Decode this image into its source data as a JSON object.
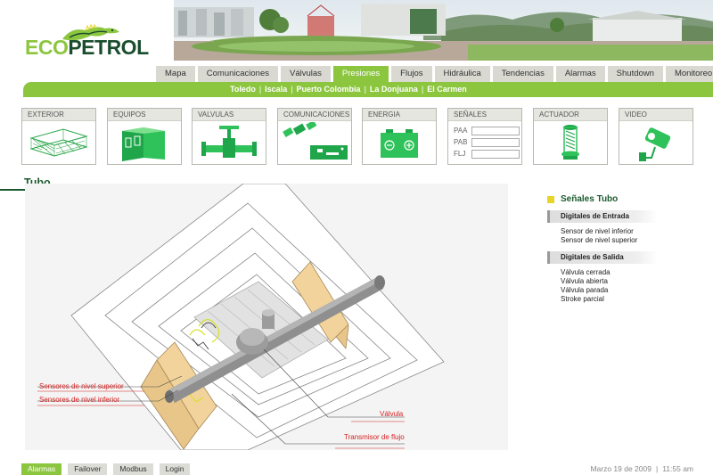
{
  "brand": {
    "eco": "ECO",
    "petrol": "PETROL"
  },
  "nav": {
    "tabs": [
      {
        "label": "Mapa"
      },
      {
        "label": "Comunicaciones"
      },
      {
        "label": "Válvulas"
      },
      {
        "label": "Presiones"
      },
      {
        "label": "Flujos"
      },
      {
        "label": "Hidráulica"
      },
      {
        "label": "Tendencias"
      },
      {
        "label": "Alarmas"
      },
      {
        "label": "Shutdown"
      },
      {
        "label": "Monitoreo"
      }
    ],
    "active_tab": "Presiones"
  },
  "stations": [
    "Toledo",
    "Iscala",
    "Puerto Colombia",
    "La Donjuana",
    "El Carmen"
  ],
  "station_sep": "|",
  "categories": {
    "exterior": "EXTERIOR",
    "equipos": "EQUIPOS",
    "valvulas": "VALVULAS",
    "comunicaciones": "COMUNICACIONES",
    "energia": "ENERGIA",
    "senales": "SEÑALES",
    "actuador": "ACTUADOR",
    "video": "VIDEO"
  },
  "signals": [
    {
      "label": "PAA",
      "value": ""
    },
    {
      "label": "PAB",
      "value": ""
    },
    {
      "label": "FLJ",
      "value": ""
    }
  ],
  "section": {
    "title": "Tubo"
  },
  "diagram": {
    "callouts": {
      "sensor_superior": "Sensores de nivel superior",
      "sensor_inferior": "Sensores de nivel inferior",
      "valvula": "Válvula",
      "transmisor": "Transmisor de flujo"
    }
  },
  "right_panel": {
    "title": "Señales Tubo",
    "digital_inputs": {
      "header": "Digitales de Entrada",
      "items": [
        "Sensor de nivel inferior",
        "Sensor de nivel superior"
      ]
    },
    "digital_outputs": {
      "header": "Digitales de Salida",
      "items": [
        "Válvula cerrada",
        "Válvula abierta",
        "Válvula parada",
        "Stroke parcial"
      ]
    }
  },
  "footer": {
    "buttons": [
      "Alarmas",
      "Failover",
      "Modbus",
      "Login"
    ],
    "active_button": "Alarmas",
    "date": "Marzo 19 de 2009",
    "sep": "|",
    "time": "11:55 am"
  },
  "colors": {
    "brand_green": "#8cc63f",
    "dark_green": "#1a5a2e",
    "callout_red": "#d62020",
    "signal_yellow": "#e8d52a"
  }
}
